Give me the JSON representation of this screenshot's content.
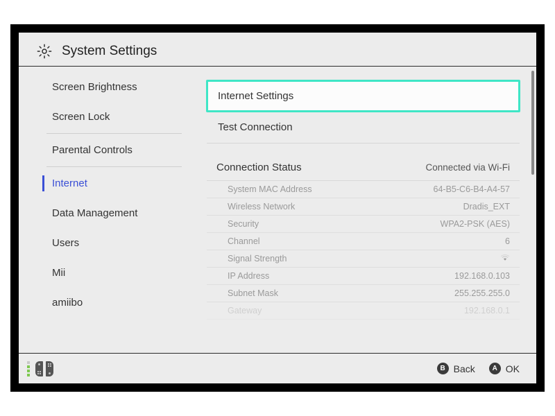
{
  "header": {
    "title": "System Settings"
  },
  "sidebar": {
    "items": [
      {
        "label": "Screen Brightness"
      },
      {
        "label": "Screen Lock"
      },
      {
        "label": "Parental Controls"
      },
      {
        "label": "Internet"
      },
      {
        "label": "Data Management"
      },
      {
        "label": "Users"
      },
      {
        "label": "Mii"
      },
      {
        "label": "amiibo"
      }
    ]
  },
  "options": {
    "internet_settings": "Internet Settings",
    "test_connection": "Test Connection"
  },
  "connection_status": {
    "header_label": "Connection Status",
    "header_value": "Connected via Wi-Fi",
    "rows": [
      {
        "label": "System MAC Address",
        "value": "64-B5-C6-B4-A4-57"
      },
      {
        "label": "Wireless Network",
        "value": "Dradis_EXT"
      },
      {
        "label": "Security",
        "value": "WPA2-PSK (AES)"
      },
      {
        "label": "Channel",
        "value": "6"
      },
      {
        "label": "Signal Strength",
        "value": ""
      },
      {
        "label": "IP Address",
        "value": "192.168.0.103"
      },
      {
        "label": "Subnet Mask",
        "value": "255.255.255.0"
      },
      {
        "label": "Gateway",
        "value": "192.168.0.1"
      }
    ]
  },
  "footer": {
    "back_glyph": "B",
    "back_label": "Back",
    "ok_glyph": "A",
    "ok_label": "OK"
  }
}
